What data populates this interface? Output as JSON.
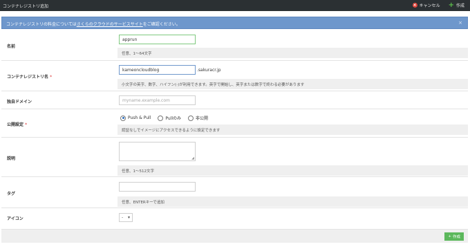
{
  "window": {
    "title": "コンテナレジストリ追加",
    "cancel_label": "キャンセル",
    "create_label": "作成"
  },
  "info_bar": {
    "prefix": "コンテナレジストリの料金については",
    "link": "さくらのクラウドのサービスサイト",
    "suffix": "をご確認ください。",
    "close": "×"
  },
  "form": {
    "name": {
      "label": "名前",
      "value": "apprun",
      "help": "任意、1〜64文字"
    },
    "registry_name": {
      "label": "コンテナレジストリ名",
      "required_mark": "*",
      "value": "kameoncloudblog",
      "suffix": ".sakuracr.jp",
      "help": "小文字の英字、数字、ハイフン(-)が利用できます。英字で開始し、英字または数字で終わる必要があります"
    },
    "custom_domain": {
      "label": "独自ドメイン",
      "placeholder": "myname.example.com"
    },
    "visibility": {
      "label": "公開設定",
      "required_mark": "*",
      "options": [
        "Push & Pull",
        "Pullのみ",
        "非公開"
      ],
      "selected": "Push & Pull",
      "help": "認証なしでイメージにアクセスできるように設定できます"
    },
    "description": {
      "label": "説明",
      "value": "",
      "help": "任意、1〜512文字"
    },
    "tags": {
      "label": "タグ",
      "value": "",
      "help": "任意、ENTERキーで追加"
    },
    "icon": {
      "label": "アイコン",
      "selected": "-"
    }
  },
  "footer": {
    "create_label": "作成"
  },
  "colors": {
    "titlebar": "#2b3033",
    "info": "#6e97cc",
    "create_button": "#5cb85c",
    "cancel_icon": "#e0433a"
  }
}
